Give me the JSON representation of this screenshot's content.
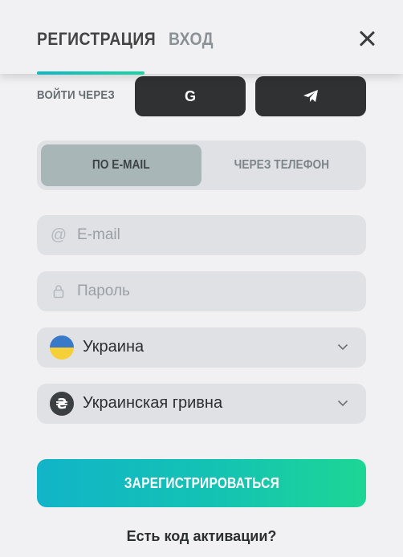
{
  "header": {
    "tabs": [
      {
        "label": "РЕГИСТРАЦИЯ",
        "active": true
      },
      {
        "label": "ВХОД",
        "active": false
      }
    ],
    "close_icon": "close-icon"
  },
  "social": {
    "label": "ВОЙТИ ЧЕРЕЗ",
    "google_letter": "G",
    "google_icon": "google-icon",
    "telegram_icon": "telegram-icon"
  },
  "method_switch": {
    "options": [
      {
        "label": "ПО E-MAIL",
        "selected": true
      },
      {
        "label": "ЧЕРЕЗ ТЕЛЕФОН",
        "selected": false
      }
    ]
  },
  "form": {
    "email": {
      "placeholder": "E-mail",
      "value": "",
      "icon": "at-icon"
    },
    "password": {
      "placeholder": "Пароль",
      "value": "",
      "icon": "lock-icon"
    },
    "country": {
      "value": "Украина",
      "icon": "ukraine-flag-icon"
    },
    "currency": {
      "value": "Украинская гривна",
      "icon": "hryvnia-icon",
      "symbol": "₴"
    }
  },
  "submit": {
    "label": "ЗАРЕГИСТРИРОВАТЬСЯ"
  },
  "activation": {
    "label": "Есть код активации?"
  },
  "colors": {
    "accent_start": "#11b4c8",
    "accent_end": "#1dd695",
    "dark_button": "#2f3133",
    "selected_option": "#a8b6b8",
    "field_bg": "#dfe1e4",
    "flag_blue": "#3a78c8",
    "flag_yellow": "#f6d038"
  }
}
